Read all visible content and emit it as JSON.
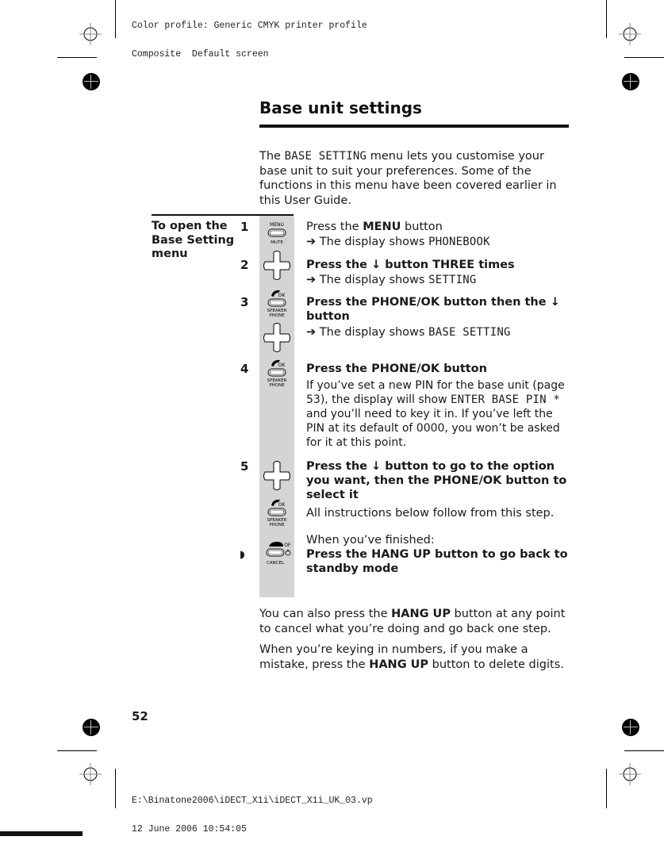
{
  "print_header": {
    "line1": "Color profile: Generic CMYK printer profile",
    "line2": "Composite  Default screen"
  },
  "print_footer": {
    "line1": "E:\\Binatone2006\\iDECT_X1i\\iDECT_X1i_UK_03.vp",
    "line2": "12 June 2006 10:54:05"
  },
  "page": {
    "title": "Base unit settings",
    "intro": {
      "pre": "The ",
      "lcd": "BASE SETTING",
      "post": " menu lets you customise your base unit to suit your preferences. Some of the functions in this menu have been covered earlier in this User Guide."
    },
    "section_label": "To open the Base Setting menu",
    "steps": [
      {
        "number": "1",
        "icon": "menu-mute-button-icon",
        "heading_pre": "Press the ",
        "heading_bold": "MENU",
        "heading_post": " button",
        "arrow": "➔",
        "display_pre": " The display shows ",
        "display_lcd": "PHONEBOOK"
      },
      {
        "number": "2",
        "icon": "navigation-pad-icon",
        "heading": "Press the ↓ button THREE times",
        "arrow": "➔",
        "display_pre": " The display shows ",
        "display_lcd": "SETTING"
      },
      {
        "number": "3",
        "icon": "phone-ok-speakerphone-button-icon",
        "heading_pre": "Press the ",
        "heading_bold": "PHONE/OK",
        "heading_post": " button then the ↓ button",
        "arrow": "➔",
        "display_pre": " The display shows ",
        "display_lcd": "BASE SETTING"
      },
      {
        "number": "4",
        "icon": "phone-ok-speakerphone-button-icon",
        "heading_pre": "Press the ",
        "heading_bold": "PHONE/OK",
        "heading_post": " button",
        "body_pre": "If you’ve set a new PIN for the base unit (page 53), the display will show ",
        "body_lcd": "ENTER BASE PIN *",
        "body_post": " and you’ll need to key it in. If you’ve left the PIN at its default of 0000, you won’t be asked for it at this point."
      },
      {
        "number": "5",
        "icon": "navigation-pad-icon",
        "heading_pre": "Press the ↓ button to go to the option you want, then the ",
        "heading_bold": "PHONE/OK",
        "heading_post": " button to select it",
        "body": "All instructions below follow from this step."
      },
      {
        "number": "◗",
        "icon": "hang-up-cancel-button-icon",
        "intro": "When you’ve finished:",
        "heading_pre": "Press the ",
        "heading_bold": "HANG UP",
        "heading_post": " button to go back to standby mode"
      }
    ],
    "icon_labels": {
      "menu": "MENU",
      "mute": "MUTE",
      "ok": "OK",
      "speaker": "SPEAKER",
      "phone": "PHONE",
      "off": "OFF",
      "cancel": "CANCEL"
    },
    "notes": [
      {
        "pre": "You can also press the ",
        "bold": "HANG UP",
        "post": " button at any point to cancel what you’re doing and go back one step."
      },
      {
        "pre": "When you’re keying in numbers, if you make a mistake, press the ",
        "bold": "HANG UP",
        "post": " button to delete digits."
      }
    ],
    "page_number": "52"
  }
}
